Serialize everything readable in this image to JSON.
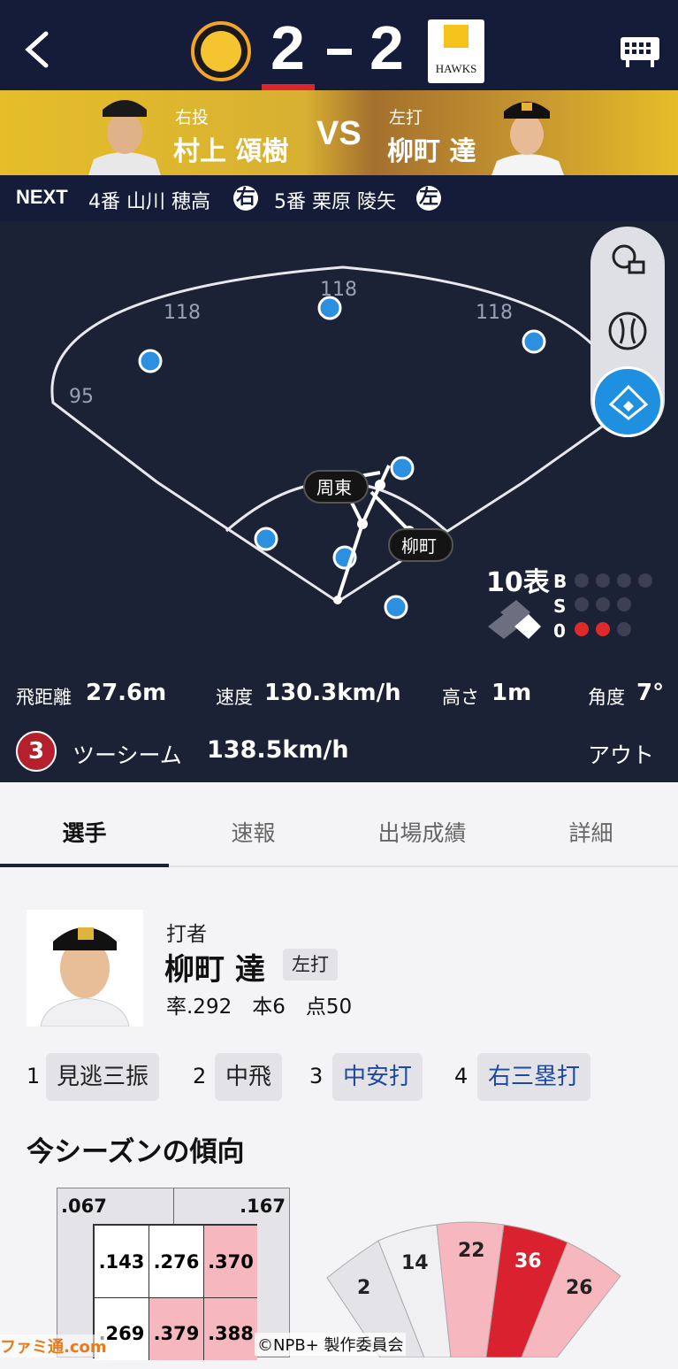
{
  "header": {
    "home_team": "Tigers",
    "away_team": "HAWKS",
    "home_score": "2",
    "away_score": "2"
  },
  "matchup": {
    "pitcher_role": "右投",
    "pitcher_name": "村上 頌樹",
    "vs": "VS",
    "batter_role": "左打",
    "batter_name": "柳町 達"
  },
  "next": {
    "label": "NEXT",
    "b1": "4番 山川 穂高",
    "b1_hand": "右",
    "b2": "5番 栗原 陵矢",
    "b2_hand": "左"
  },
  "field": {
    "dist_left": "118",
    "dist_center": "118",
    "dist_right": "118",
    "dist_leftline": "95",
    "runner1": "周東",
    "runner2": "柳町",
    "inning": "10表",
    "balls": "B",
    "strikes": "S",
    "outs": "0"
  },
  "stats": {
    "dist_label": "飛距離",
    "dist_value": "27.6m",
    "speed_label": "速度",
    "speed_value": "130.3km/h",
    "height_label": "高さ",
    "height_value": "1m",
    "angle_label": "角度",
    "angle_value": "7°",
    "pitch_no": "3",
    "pitch_type": "ツーシーム",
    "pitch_speed": "138.5km/h",
    "result": "アウト"
  },
  "tabs": [
    "選手",
    "速報",
    "出場成績",
    "詳細"
  ],
  "player": {
    "role": "打者",
    "name": "柳町 達",
    "hand": "左打",
    "line": "率.292　本6　点50"
  },
  "atbats": [
    {
      "n": "1",
      "r": "見逃三振"
    },
    {
      "n": "2",
      "r": "中飛"
    },
    {
      "n": "3",
      "r": "中安打"
    },
    {
      "n": "4",
      "r": "右三塁打"
    }
  ],
  "season": {
    "title": "今シーズンの傾向",
    "zone_tl": ".067",
    "zone_tr": ".167",
    "zone": [
      ".143",
      ".276",
      ".370",
      ".269",
      ".379",
      ".388"
    ],
    "fan": [
      "2",
      "14",
      "22",
      "36",
      "26"
    ]
  },
  "credit": "©NPB+ 製作委員会",
  "watermark": "ファミ通.com"
}
